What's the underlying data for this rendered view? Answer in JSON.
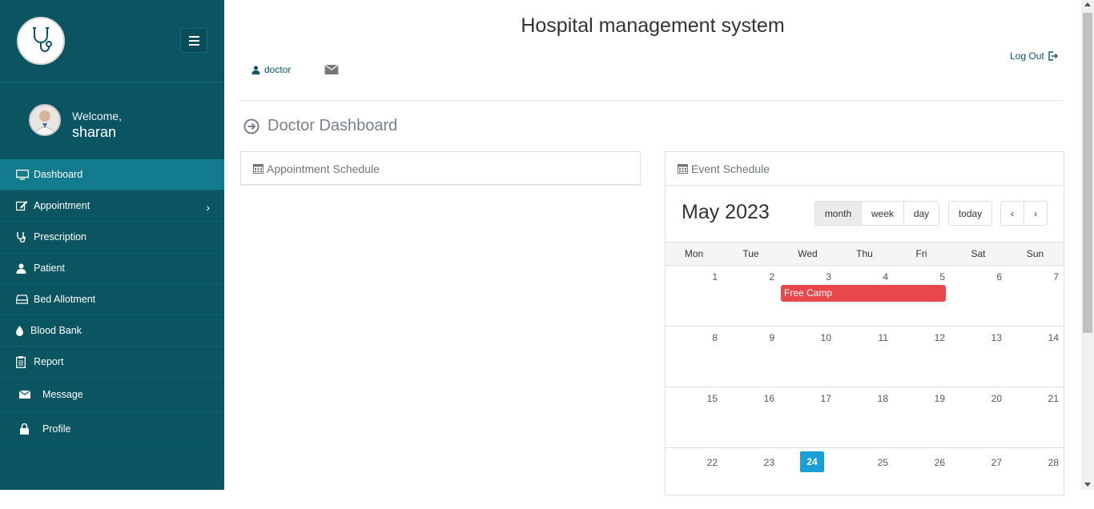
{
  "app": {
    "title": "Hospital management system"
  },
  "sidebar": {
    "welcome": "Welcome,",
    "user_name": "sharan",
    "items": [
      {
        "label": "Dashboard",
        "icon": "monitor-icon",
        "active": true
      },
      {
        "label": "Appointment",
        "icon": "edit-icon",
        "has_sub": true
      },
      {
        "label": "Prescription",
        "icon": "stethoscope-icon"
      },
      {
        "label": "Patient",
        "icon": "user-icon"
      },
      {
        "label": "Bed Allotment",
        "icon": "hdd-icon"
      },
      {
        "label": "Blood Bank",
        "icon": "tint-icon"
      },
      {
        "label": "Report",
        "icon": "clipboard-icon"
      },
      {
        "label": "Message",
        "icon": "envelope-icon"
      },
      {
        "label": "Profile",
        "icon": "lock-icon"
      }
    ]
  },
  "header": {
    "user": "doctor",
    "logout": "Log Out"
  },
  "page": {
    "heading": "Doctor Dashboard"
  },
  "appointments": {
    "title": "Appointment Schedule"
  },
  "events": {
    "title": "Event Schedule",
    "month_title": "May 2023",
    "views": {
      "month": "month",
      "week": "week",
      "day": "day"
    },
    "today_label": "today",
    "prev": "‹",
    "next": "›",
    "weekdays": [
      "Mon",
      "Tue",
      "Wed",
      "Thu",
      "Fri",
      "Sat",
      "Sun"
    ],
    "weeks": [
      [
        "1",
        "2",
        "3",
        "4",
        "5",
        "6",
        "7"
      ],
      [
        "8",
        "9",
        "10",
        "11",
        "12",
        "13",
        "14"
      ],
      [
        "15",
        "16",
        "17",
        "18",
        "19",
        "20",
        "21"
      ],
      [
        "22",
        "23",
        "24",
        "25",
        "26",
        "27",
        "28"
      ]
    ],
    "event_name": "Free Camp",
    "today_date": "24"
  },
  "colors": {
    "sidebar": "#0b5563",
    "active": "#137b8e",
    "event": "#e8474b",
    "today": "#1a9fd8"
  }
}
